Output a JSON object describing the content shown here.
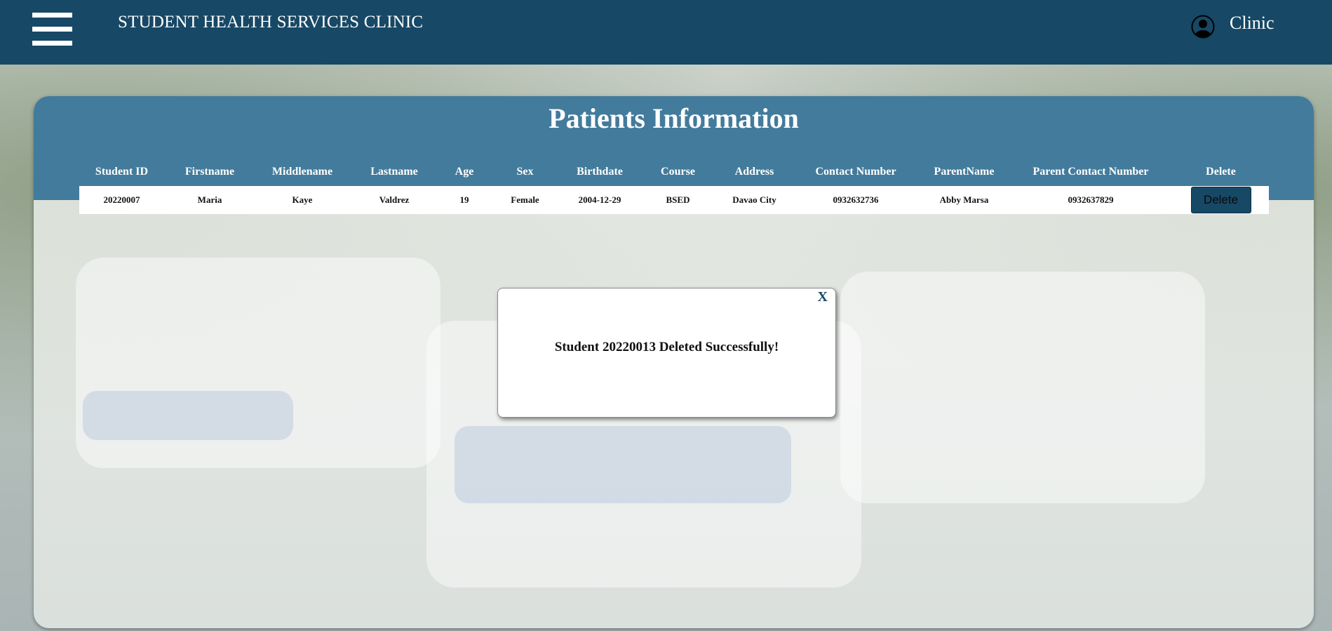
{
  "header": {
    "title": "STUDENT HEALTH SERVICES CLINIC",
    "user_label": "Clinic",
    "menu_icon": "hamburger-menu-icon",
    "user_icon": "user-circle-icon",
    "background_color": "#174866"
  },
  "panel": {
    "title": "Patients Information",
    "header_color": "#427b9c"
  },
  "table": {
    "columns": [
      "Student ID",
      "Firstname",
      "Middlename",
      "Lastname",
      "Age",
      "Sex",
      "Birthdate",
      "Course",
      "Address",
      "Contact Number",
      "ParentName",
      "Parent Contact Number",
      "Delete"
    ],
    "rows": [
      {
        "student_id": "20220007",
        "firstname": "Maria",
        "middlename": "Kaye",
        "lastname": "Valdrez",
        "age": "19",
        "sex": "Female",
        "birthdate": "2004-12-29",
        "course": "BSED",
        "address": "Davao City",
        "contact_number": "0932632736",
        "parent_name": "Abby Marsa",
        "parent_contact_number": "0932637829",
        "delete_label": "Delete"
      }
    ]
  },
  "modal": {
    "close_label": "X",
    "message": "Student 20220013 Deleted Successfully!"
  }
}
